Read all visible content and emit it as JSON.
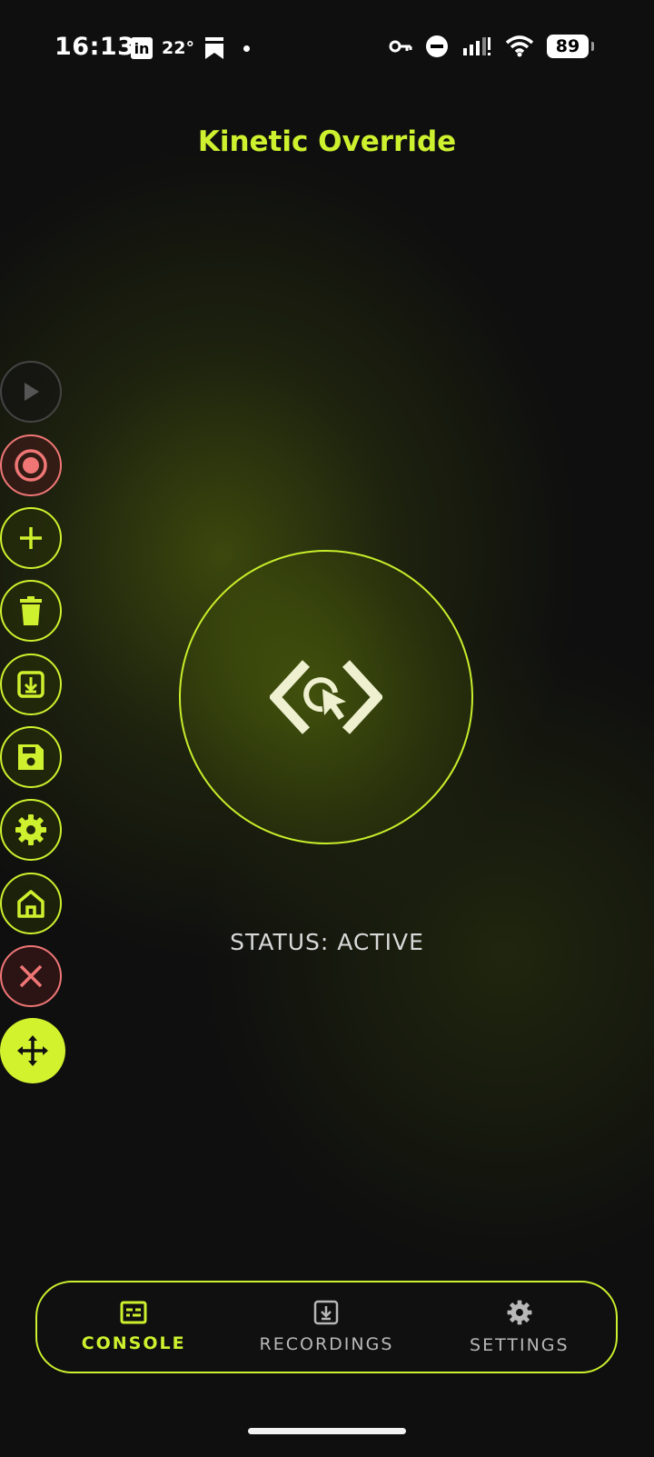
{
  "status_bar": {
    "time": "16:13",
    "linkedin": "in",
    "temperature": "22°",
    "battery": "89"
  },
  "app": {
    "title": "Kinetic Override"
  },
  "tools": [
    {
      "name": "play-icon",
      "style": "grey"
    },
    {
      "name": "record-icon",
      "style": "red"
    },
    {
      "name": "add-icon",
      "style": "lime"
    },
    {
      "name": "trash-icon",
      "style": "lime"
    },
    {
      "name": "import-icon",
      "style": "lime"
    },
    {
      "name": "save-icon",
      "style": "lime"
    },
    {
      "name": "gear-icon",
      "style": "lime"
    },
    {
      "name": "home-icon",
      "style": "lime"
    },
    {
      "name": "close-icon",
      "style": "red"
    },
    {
      "name": "move-icon",
      "style": "filled"
    }
  ],
  "main": {
    "center_icon": "code-click-icon",
    "status": "STATUS: ACTIVE"
  },
  "nav": {
    "items": [
      {
        "label": "CONSOLE",
        "icon": "console-icon",
        "active": true
      },
      {
        "label": "RECORDINGS",
        "icon": "download-icon",
        "active": false
      },
      {
        "label": "SETTINGS",
        "icon": "gear-icon",
        "active": false
      }
    ]
  },
  "colors": {
    "accent": "#cdf12e",
    "danger": "#f07676",
    "background": "#0f0f0f"
  }
}
